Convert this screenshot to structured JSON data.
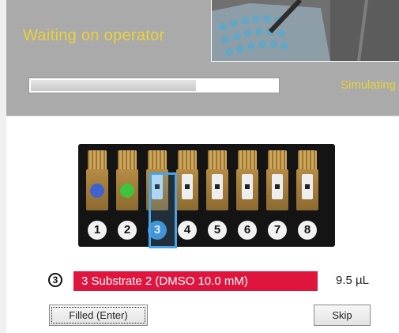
{
  "status": {
    "title": "Waiting on operator",
    "progress": 0.67,
    "mode_label": "Simulating",
    "title_color": "#e8d23a"
  },
  "plate": {
    "wells": [
      {
        "number": "❶",
        "fill": "#3f62d0",
        "state": "filled"
      },
      {
        "number": "❷",
        "fill": "#3cc43c",
        "state": "filled"
      },
      {
        "number": "❸",
        "fill": null,
        "state": "active"
      },
      {
        "number": "❹",
        "fill": null,
        "state": "empty"
      },
      {
        "number": "❺",
        "fill": null,
        "state": "empty"
      },
      {
        "number": "❻",
        "fill": null,
        "state": "empty"
      },
      {
        "number": "❼",
        "fill": null,
        "state": "empty"
      },
      {
        "number": "❽",
        "fill": null,
        "state": "empty"
      }
    ],
    "active_index": 2,
    "highlight_color": "#4aa3e6"
  },
  "current": {
    "badge": "3",
    "label": "3  Substrate 2 (DMSO  10.0 mM)",
    "volume": "9.5 µL",
    "bar_color": "#e0153e"
  },
  "actions": {
    "filled_label": "Filled  (Enter)",
    "skip_label": "Skip"
  }
}
